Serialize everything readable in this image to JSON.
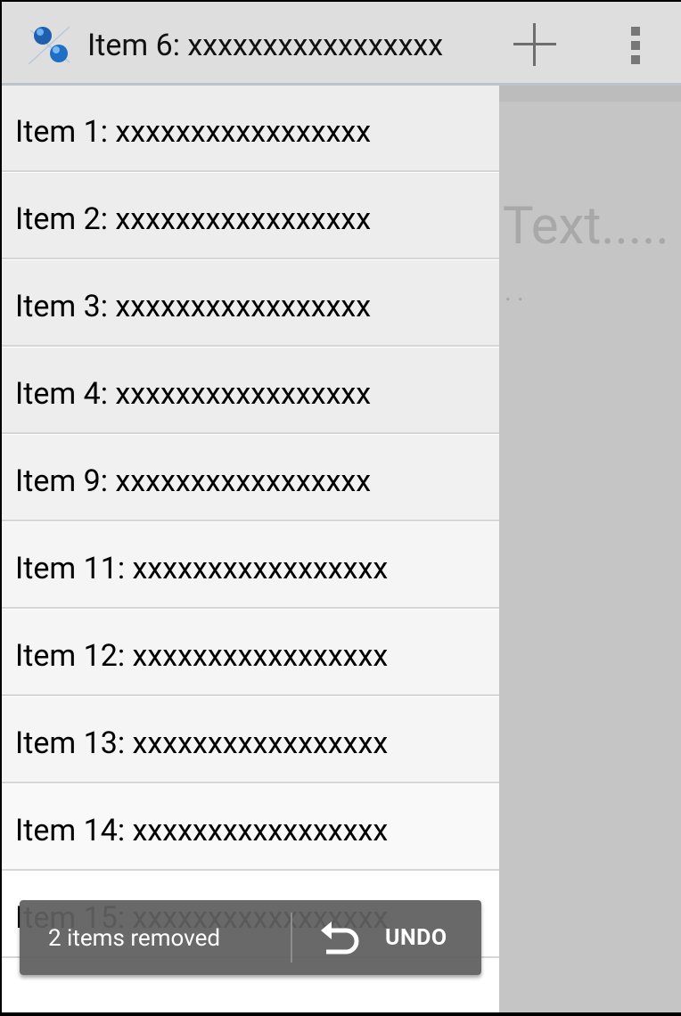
{
  "action_bar": {
    "app_icon": "pushpin-icon",
    "title": "Item 6: xxxxxxxxxxxxxxxxx",
    "add_icon": "plus-icon",
    "overflow_icon": "overflow-menu-icon"
  },
  "list": {
    "items": [
      {
        "label": "Item 1: xxxxxxxxxxxxxxxxx"
      },
      {
        "label": "Item 2: xxxxxxxxxxxxxxxxx"
      },
      {
        "label": "Item 3: xxxxxxxxxxxxxxxxx"
      },
      {
        "label": "Item 4: xxxxxxxxxxxxxxxxx"
      },
      {
        "label": "Item 9: xxxxxxxxxxxxxxxxx"
      },
      {
        "label": "Item 11: xxxxxxxxxxxxxxxxx"
      },
      {
        "label": "Item 12: xxxxxxxxxxxxxxxxx"
      },
      {
        "label": "Item 13: xxxxxxxxxxxxxxxxx"
      },
      {
        "label": "Item 14: xxxxxxxxxxxxxxxxx"
      },
      {
        "label": "Item 15: xxxxxxxxxxxxxxxxx"
      }
    ]
  },
  "detail": {
    "text": "Text.....",
    "dots": ".."
  },
  "undo_bar": {
    "message": "2 items removed",
    "button_label": "UNDO",
    "icon": "undo-icon"
  },
  "colors": {
    "action_bar_bg": "#dedede",
    "list_bg": "#ececec",
    "detail_bg": "#c5c5c5",
    "undo_bar_bg": "#606060",
    "icon_blue": "#1f6fc4"
  }
}
